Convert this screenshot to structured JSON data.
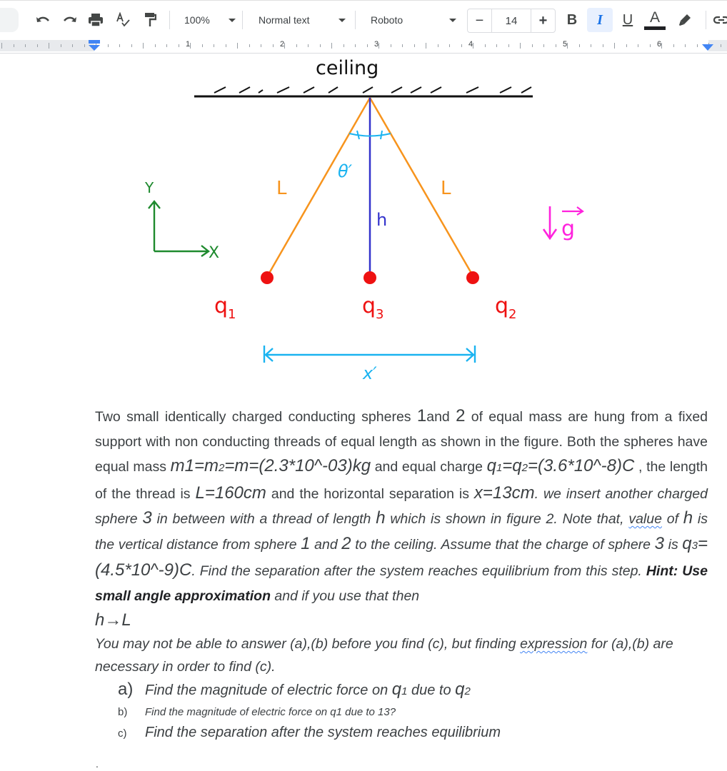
{
  "toolbar": {
    "zoom": "100%",
    "style": "Normal text",
    "font": "Roboto",
    "font_size": "14",
    "decrease_label": "−",
    "increase_label": "+",
    "bold_label": "B",
    "italic_label": "I",
    "underline_label": "U",
    "text_color_label": "A",
    "italic_active": true,
    "icons": [
      "undo-icon",
      "redo-icon",
      "print-icon",
      "spellcheck-icon",
      "paint-format-icon",
      "highlighter-icon",
      "link-icon"
    ]
  },
  "ruler": {
    "numbers": [
      "1",
      "2",
      "3",
      "4",
      "5",
      "6"
    ]
  },
  "figure": {
    "ceiling_label": "ceiling",
    "thread_left_label": "L",
    "thread_right_label": "L",
    "angle_label": "θ′",
    "h_label": "h",
    "axis_y_label": "Y",
    "axis_x_label": "X",
    "gravity_label": "g",
    "q1_label": "q",
    "q1_sub": "1",
    "q2_label": "q",
    "q2_sub": "2",
    "q3_label": "q",
    "q3_sub": "3",
    "separation_label": "x′",
    "colors": {
      "thread": "#f7941d",
      "center_thread": "#3333cc",
      "sphere": "#ee1111",
      "axes": "#1e8a2e",
      "gravity": "#ff22dd",
      "dimension": "#1ab3f0",
      "ceiling": "#111111"
    }
  },
  "problem": {
    "p1_a": "Two small identically charged conducting spheres ",
    "p1_n1": "1",
    "p1_b": "and ",
    "p1_n2": "2",
    "p1_c": " of equal mass are hung from a fixed support with non conducting threads of equal length as shown in the figure. Both the spheres have equal mass ",
    "mass_m1": "m1=m",
    "mass_sub": "2",
    "mass_rest": "=m=(2.3*10^-03)kg",
    "p1_d": " and equal charge ",
    "q_q": "q",
    "q_sub1": "1",
    "q_eq": "=q",
    "q_sub2": "2",
    "q_rest": "=(3.6*10^-8)C",
    "p1_e": " , the length of the thread is ",
    "length_val": "L=160cm",
    "p1_f": " and the horizontal separation is ",
    "sep_val": "x=13cm",
    "p1_g": ". we insert another charged sphere ",
    "n3": "3",
    "p1_h": " in between with a thread of length ",
    "h_sym": "h",
    "p1_i": " which is shown in figure 2. Note that, ",
    "value_word": "value",
    "p1_j": " of ",
    "p1_k": " is the vertical distance from sphere ",
    "p1_l": " and ",
    "p1_m": " to the ceiling. Assume that the charge of sphere ",
    "p1_n": " is ",
    "q3_q": "q",
    "q3_sub": "3",
    "q3_rest": "=(4.5*10^-9)C",
    "p1_o": ". Find the separation after the system reaches equilibrium from this step. ",
    "hint": "Hint: Use small angle approximation",
    "p1_p": " and if you use that then",
    "limit": "h→L",
    "p2_a": "You may not be able to answer (a),(b) before you find (c), but finding ",
    "expression_word": "expression",
    "p2_b": " for (a),(b) are necessary in order to find (c).",
    "items": [
      {
        "marker": "a)",
        "text_a": "Find the magnitude of electric force on ",
        "q": "q",
        "s1": "1",
        "mid": " due to ",
        "q2": "q",
        "s2": "2"
      },
      {
        "marker": "b)",
        "text": "Find the magnitude of electric force on q1 due to 13?"
      },
      {
        "marker": "c)",
        "text": "Find the separation after the system reaches equilibrium"
      }
    ],
    "trailing": "."
  }
}
